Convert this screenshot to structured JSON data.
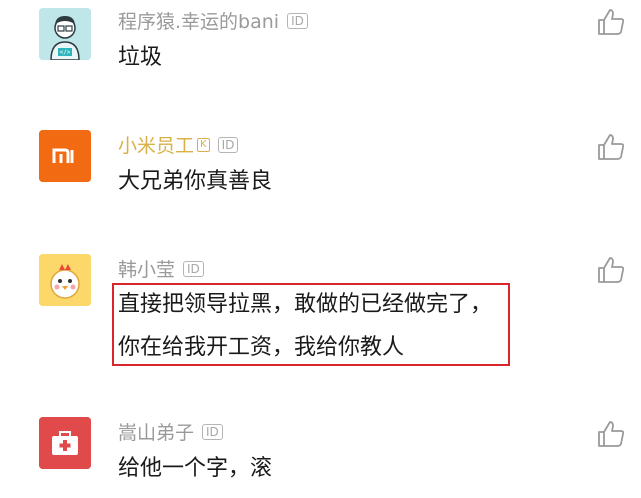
{
  "comments": [
    {
      "username": "程序猿.幸运的bani",
      "text": "垃圾",
      "id_badge": "ID",
      "avatar": "coder-avatar"
    },
    {
      "username": "小米员工",
      "text": "大兄弟你真善良",
      "id_badge": "ID",
      "employee_badge": "K",
      "username_color": "#d9b04a",
      "avatar": "xiaomi-logo-avatar"
    },
    {
      "username": "韩小莹",
      "text_line1": "直接把领导拉黑，敢做的已经做完了，",
      "text_line2": "你在给我开工资，我给你教人",
      "id_badge": "ID",
      "avatar": "chick-avatar",
      "highlighted": true
    },
    {
      "username": "嵩山弟子",
      "text": "给他一个字，滚",
      "id_badge": "ID",
      "avatar": "medical-kit-avatar"
    }
  ],
  "icons": {
    "like": "thumbs-up-icon"
  },
  "colors": {
    "highlight": "#d9262b",
    "xiaomi": "#f26a12",
    "medical": "#e04a4a",
    "coder": "#bfe7ea",
    "chick": "#fcd86a"
  }
}
